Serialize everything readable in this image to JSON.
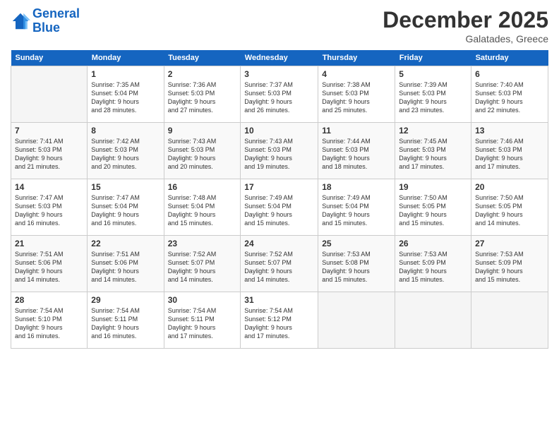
{
  "logo": {
    "line1": "General",
    "line2": "Blue"
  },
  "title": "December 2025",
  "location": "Galatades, Greece",
  "days_header": [
    "Sunday",
    "Monday",
    "Tuesday",
    "Wednesday",
    "Thursday",
    "Friday",
    "Saturday"
  ],
  "weeks": [
    [
      {
        "num": "",
        "info": ""
      },
      {
        "num": "1",
        "info": "Sunrise: 7:35 AM\nSunset: 5:04 PM\nDaylight: 9 hours\nand 28 minutes."
      },
      {
        "num": "2",
        "info": "Sunrise: 7:36 AM\nSunset: 5:03 PM\nDaylight: 9 hours\nand 27 minutes."
      },
      {
        "num": "3",
        "info": "Sunrise: 7:37 AM\nSunset: 5:03 PM\nDaylight: 9 hours\nand 26 minutes."
      },
      {
        "num": "4",
        "info": "Sunrise: 7:38 AM\nSunset: 5:03 PM\nDaylight: 9 hours\nand 25 minutes."
      },
      {
        "num": "5",
        "info": "Sunrise: 7:39 AM\nSunset: 5:03 PM\nDaylight: 9 hours\nand 23 minutes."
      },
      {
        "num": "6",
        "info": "Sunrise: 7:40 AM\nSunset: 5:03 PM\nDaylight: 9 hours\nand 22 minutes."
      }
    ],
    [
      {
        "num": "7",
        "info": "Sunrise: 7:41 AM\nSunset: 5:03 PM\nDaylight: 9 hours\nand 21 minutes."
      },
      {
        "num": "8",
        "info": "Sunrise: 7:42 AM\nSunset: 5:03 PM\nDaylight: 9 hours\nand 20 minutes."
      },
      {
        "num": "9",
        "info": "Sunrise: 7:43 AM\nSunset: 5:03 PM\nDaylight: 9 hours\nand 20 minutes."
      },
      {
        "num": "10",
        "info": "Sunrise: 7:43 AM\nSunset: 5:03 PM\nDaylight: 9 hours\nand 19 minutes."
      },
      {
        "num": "11",
        "info": "Sunrise: 7:44 AM\nSunset: 5:03 PM\nDaylight: 9 hours\nand 18 minutes."
      },
      {
        "num": "12",
        "info": "Sunrise: 7:45 AM\nSunset: 5:03 PM\nDaylight: 9 hours\nand 17 minutes."
      },
      {
        "num": "13",
        "info": "Sunrise: 7:46 AM\nSunset: 5:03 PM\nDaylight: 9 hours\nand 17 minutes."
      }
    ],
    [
      {
        "num": "14",
        "info": "Sunrise: 7:47 AM\nSunset: 5:03 PM\nDaylight: 9 hours\nand 16 minutes."
      },
      {
        "num": "15",
        "info": "Sunrise: 7:47 AM\nSunset: 5:04 PM\nDaylight: 9 hours\nand 16 minutes."
      },
      {
        "num": "16",
        "info": "Sunrise: 7:48 AM\nSunset: 5:04 PM\nDaylight: 9 hours\nand 15 minutes."
      },
      {
        "num": "17",
        "info": "Sunrise: 7:49 AM\nSunset: 5:04 PM\nDaylight: 9 hours\nand 15 minutes."
      },
      {
        "num": "18",
        "info": "Sunrise: 7:49 AM\nSunset: 5:04 PM\nDaylight: 9 hours\nand 15 minutes."
      },
      {
        "num": "19",
        "info": "Sunrise: 7:50 AM\nSunset: 5:05 PM\nDaylight: 9 hours\nand 15 minutes."
      },
      {
        "num": "20",
        "info": "Sunrise: 7:50 AM\nSunset: 5:05 PM\nDaylight: 9 hours\nand 14 minutes."
      }
    ],
    [
      {
        "num": "21",
        "info": "Sunrise: 7:51 AM\nSunset: 5:06 PM\nDaylight: 9 hours\nand 14 minutes."
      },
      {
        "num": "22",
        "info": "Sunrise: 7:51 AM\nSunset: 5:06 PM\nDaylight: 9 hours\nand 14 minutes."
      },
      {
        "num": "23",
        "info": "Sunrise: 7:52 AM\nSunset: 5:07 PM\nDaylight: 9 hours\nand 14 minutes."
      },
      {
        "num": "24",
        "info": "Sunrise: 7:52 AM\nSunset: 5:07 PM\nDaylight: 9 hours\nand 14 minutes."
      },
      {
        "num": "25",
        "info": "Sunrise: 7:53 AM\nSunset: 5:08 PM\nDaylight: 9 hours\nand 15 minutes."
      },
      {
        "num": "26",
        "info": "Sunrise: 7:53 AM\nSunset: 5:09 PM\nDaylight: 9 hours\nand 15 minutes."
      },
      {
        "num": "27",
        "info": "Sunrise: 7:53 AM\nSunset: 5:09 PM\nDaylight: 9 hours\nand 15 minutes."
      }
    ],
    [
      {
        "num": "28",
        "info": "Sunrise: 7:54 AM\nSunset: 5:10 PM\nDaylight: 9 hours\nand 16 minutes."
      },
      {
        "num": "29",
        "info": "Sunrise: 7:54 AM\nSunset: 5:11 PM\nDaylight: 9 hours\nand 16 minutes."
      },
      {
        "num": "30",
        "info": "Sunrise: 7:54 AM\nSunset: 5:11 PM\nDaylight: 9 hours\nand 17 minutes."
      },
      {
        "num": "31",
        "info": "Sunrise: 7:54 AM\nSunset: 5:12 PM\nDaylight: 9 hours\nand 17 minutes."
      },
      {
        "num": "",
        "info": ""
      },
      {
        "num": "",
        "info": ""
      },
      {
        "num": "",
        "info": ""
      }
    ]
  ]
}
